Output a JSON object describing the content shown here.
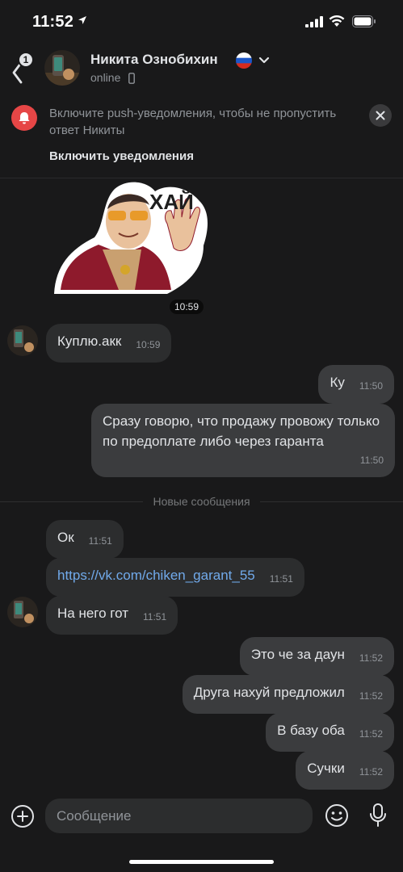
{
  "status_bar": {
    "time": "11:52"
  },
  "header": {
    "back_badge": "1",
    "contact_name": "Никита Ознобихин",
    "status": "online"
  },
  "banner": {
    "text": "Включите push-уведомления, чтобы не пропустить ответ Никиты",
    "action": "Включить уведомления"
  },
  "sticker": {
    "caption": "ХАЙ",
    "time": "10:59"
  },
  "divider_label": "Новые сообщения",
  "messages": [
    {
      "text": "Куплю.акк",
      "time": "10:59",
      "dir": "in"
    },
    {
      "text": "Ку",
      "time": "11:50",
      "dir": "out"
    },
    {
      "text": "Сразу говорю, что продажу провожу только по предоплате либо через гаранта",
      "time": "11:50",
      "dir": "out"
    },
    {
      "text": "Ок",
      "time": "11:51",
      "dir": "in"
    },
    {
      "text": "https://vk.com/chiken_garant_55",
      "time": "11:51",
      "dir": "in"
    },
    {
      "text": "На него гот",
      "time": "11:51",
      "dir": "in"
    },
    {
      "text": "Это че за даун",
      "time": "11:52",
      "dir": "out"
    },
    {
      "text": "Друга нахуй предложил",
      "time": "11:52",
      "dir": "out"
    },
    {
      "text": "В базу оба",
      "time": "11:52",
      "dir": "out"
    },
    {
      "text": "Сучки",
      "time": "11:52",
      "dir": "out"
    }
  ],
  "composer": {
    "placeholder": "Сообщение"
  },
  "colors": {
    "background": "#19191a",
    "bubble_in": "#2c2d2e",
    "bubble_out": "#3b3c3e",
    "link": "#71aaeb",
    "badge_red": "#e64646"
  },
  "icons": [
    "location-arrow-icon",
    "signal-icon",
    "wifi-icon",
    "battery-icon",
    "back-icon",
    "russia-flag-icon",
    "chevron-down-icon",
    "phone-icon",
    "bell-icon",
    "close-icon",
    "plus-icon",
    "smile-icon",
    "microphone-icon"
  ]
}
